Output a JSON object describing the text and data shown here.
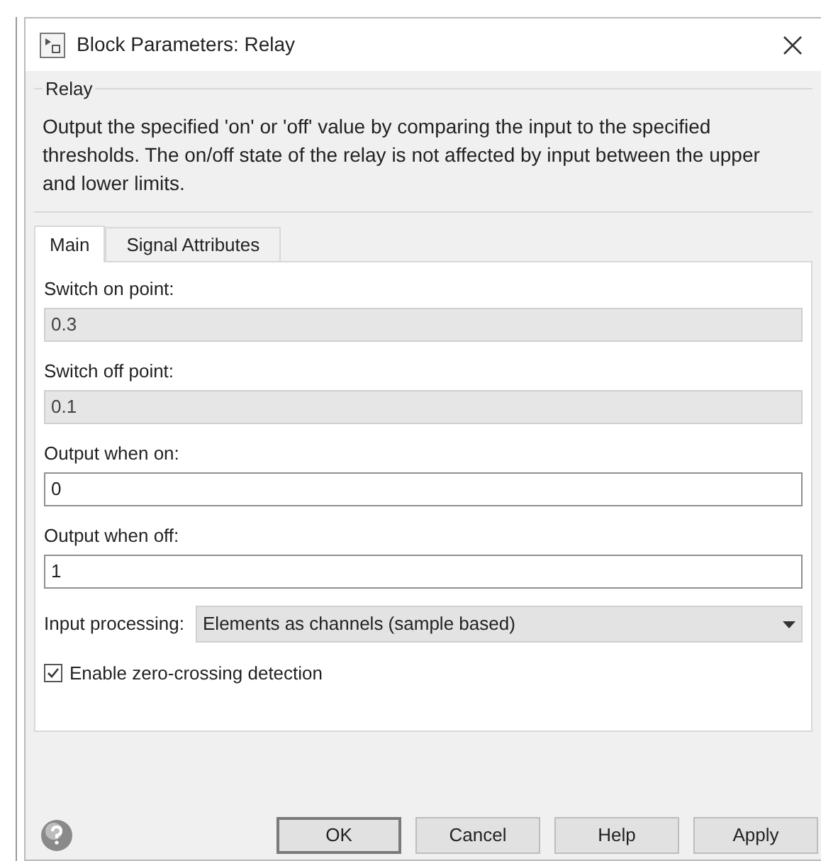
{
  "window": {
    "title": "Block Parameters: Relay"
  },
  "group": {
    "title": "Relay",
    "description": "Output the specified 'on' or 'off' value by comparing the input to the specified thresholds.  The on/off state of the relay is not affected by input between the upper and lower limits."
  },
  "tabs": [
    {
      "label": "Main",
      "selected": true
    },
    {
      "label": "Signal Attributes",
      "selected": false
    }
  ],
  "parameters": [
    {
      "label": "Switch on point:",
      "value": "0.3",
      "disabled": true
    },
    {
      "label": "Switch off point:",
      "value": "0.1",
      "disabled": true
    },
    {
      "label": "Output when on:",
      "value": "0",
      "disabled": false
    },
    {
      "label": "Output when off:",
      "value": "1",
      "disabled": false
    }
  ],
  "input_processing": {
    "label": "Input processing:",
    "value": "Elements as channels (sample based)"
  },
  "zero_crossing": {
    "label": "Enable zero-crossing detection",
    "checked": true
  },
  "buttons": [
    {
      "label": "OK",
      "default": true
    },
    {
      "label": "Cancel",
      "default": false
    },
    {
      "label": "Help",
      "default": false
    },
    {
      "label": "Apply",
      "default": false
    }
  ]
}
